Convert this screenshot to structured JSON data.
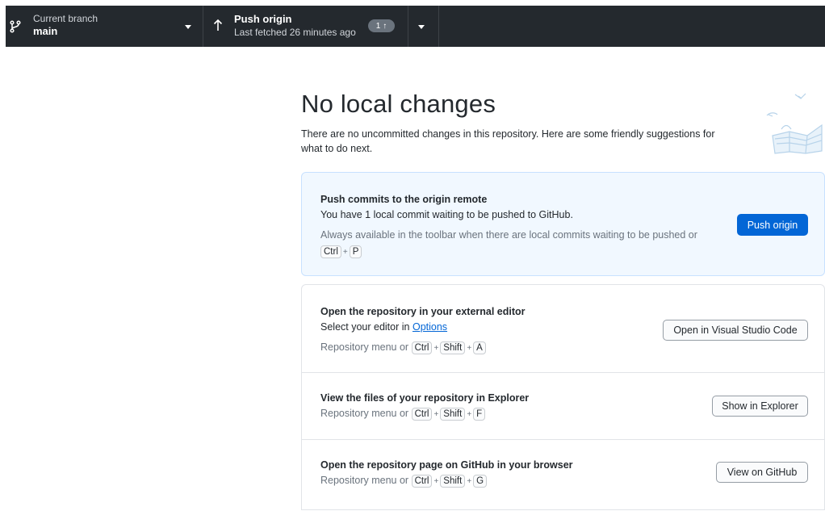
{
  "toolbar": {
    "branch": {
      "label": "Current branch",
      "value": "main"
    },
    "push": {
      "label": "Push origin",
      "sub": "Last fetched 26 minutes ago",
      "badge_count": "1",
      "badge_arrow": "↑"
    }
  },
  "main": {
    "title": "No local changes",
    "subtitle": "There are no uncommitted changes in this repository. Here are some friendly suggestions for what to do next."
  },
  "push_card": {
    "title": "Push commits to the origin remote",
    "description": "You have 1 local commit waiting to be pushed to GitHub.",
    "hint": "Always available in the toolbar when there are local commits waiting to be pushed or",
    "shortcut": [
      "Ctrl",
      "P"
    ],
    "button": "Push origin"
  },
  "suggestions": {
    "editor": {
      "title": "Open the repository in your external editor",
      "desc_prefix": "Select your editor in",
      "desc_link": "Options",
      "hint": "Repository menu or",
      "shortcut": [
        "Ctrl",
        "Shift",
        "A"
      ],
      "button": "Open in Visual Studio Code"
    },
    "explorer": {
      "title": "View the files of your repository in Explorer",
      "hint": "Repository menu or",
      "shortcut": [
        "Ctrl",
        "Shift",
        "F"
      ],
      "button": "Show in Explorer"
    },
    "github": {
      "title": "Open the repository page on GitHub in your browser",
      "hint": "Repository menu or",
      "shortcut": [
        "Ctrl",
        "Shift",
        "G"
      ],
      "button": "View on GitHub"
    }
  },
  "shortcut_separator": "+",
  "colors": {
    "toolbar_bg": "#24292e",
    "accent": "#0366d6",
    "highlight_bg": "#f1f8ff"
  }
}
